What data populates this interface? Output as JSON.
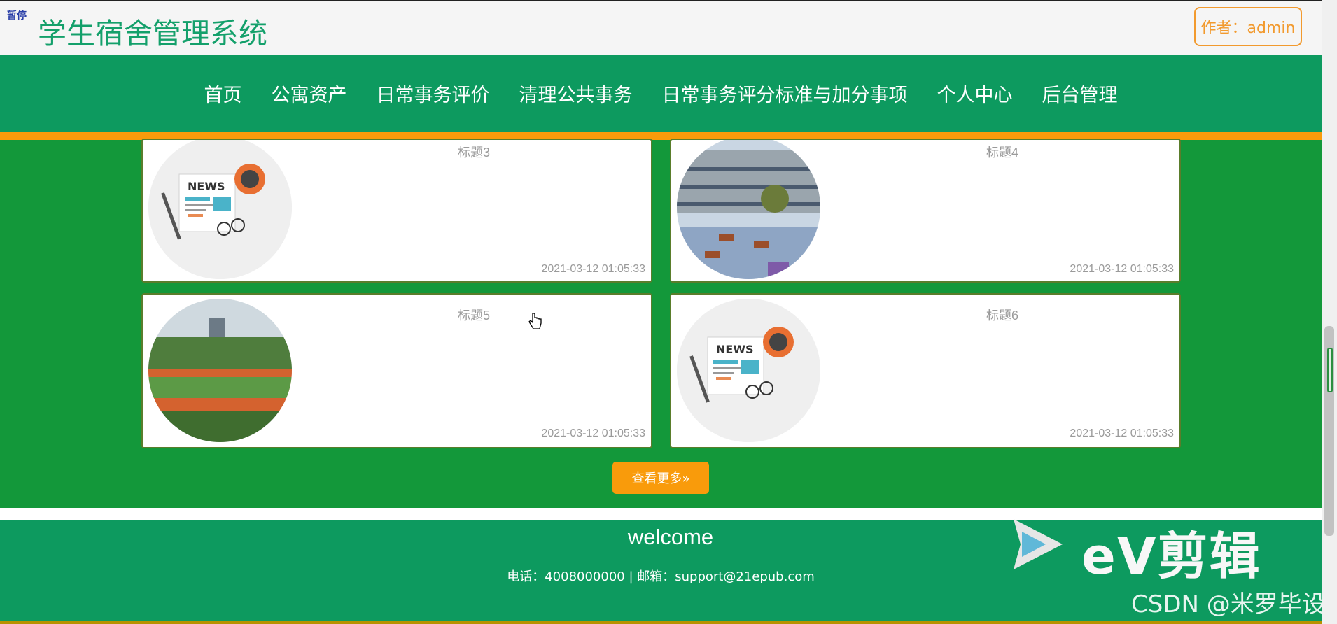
{
  "header": {
    "pause_tag": "暂停",
    "title": "学生宿舍管理系统",
    "author_label": "作者：admin"
  },
  "nav": {
    "items": [
      {
        "label": "首页"
      },
      {
        "label": "公寓资产"
      },
      {
        "label": "日常事务评价"
      },
      {
        "label": "清理公共事务"
      },
      {
        "label": "日常事务评分标准与加分事项"
      },
      {
        "label": "个人中心"
      },
      {
        "label": "后台管理"
      }
    ]
  },
  "cards": [
    {
      "title": "标题3",
      "date": "2021-03-12 01:05:33",
      "image": "news-illustration"
    },
    {
      "title": "标题4",
      "date": "2021-03-12 01:05:33",
      "image": "campus-building-photo"
    },
    {
      "title": "标题5",
      "date": "2021-03-12 01:05:33",
      "image": "sports-field-photo"
    },
    {
      "title": "标题6",
      "date": "2021-03-12 01:05:33",
      "image": "news-illustration"
    }
  ],
  "more_button": {
    "label": "查看更多»"
  },
  "footer": {
    "welcome": "welcome",
    "contact": "电话：4008000000 | 邮箱：support@21epub.com"
  },
  "watermarks": {
    "ev_text": "eV剪辑",
    "csdn": "CSDN @米罗毕设"
  },
  "colors": {
    "green": "#0d9a5f",
    "content_green": "#13983a",
    "orange": "#f99b0b"
  }
}
